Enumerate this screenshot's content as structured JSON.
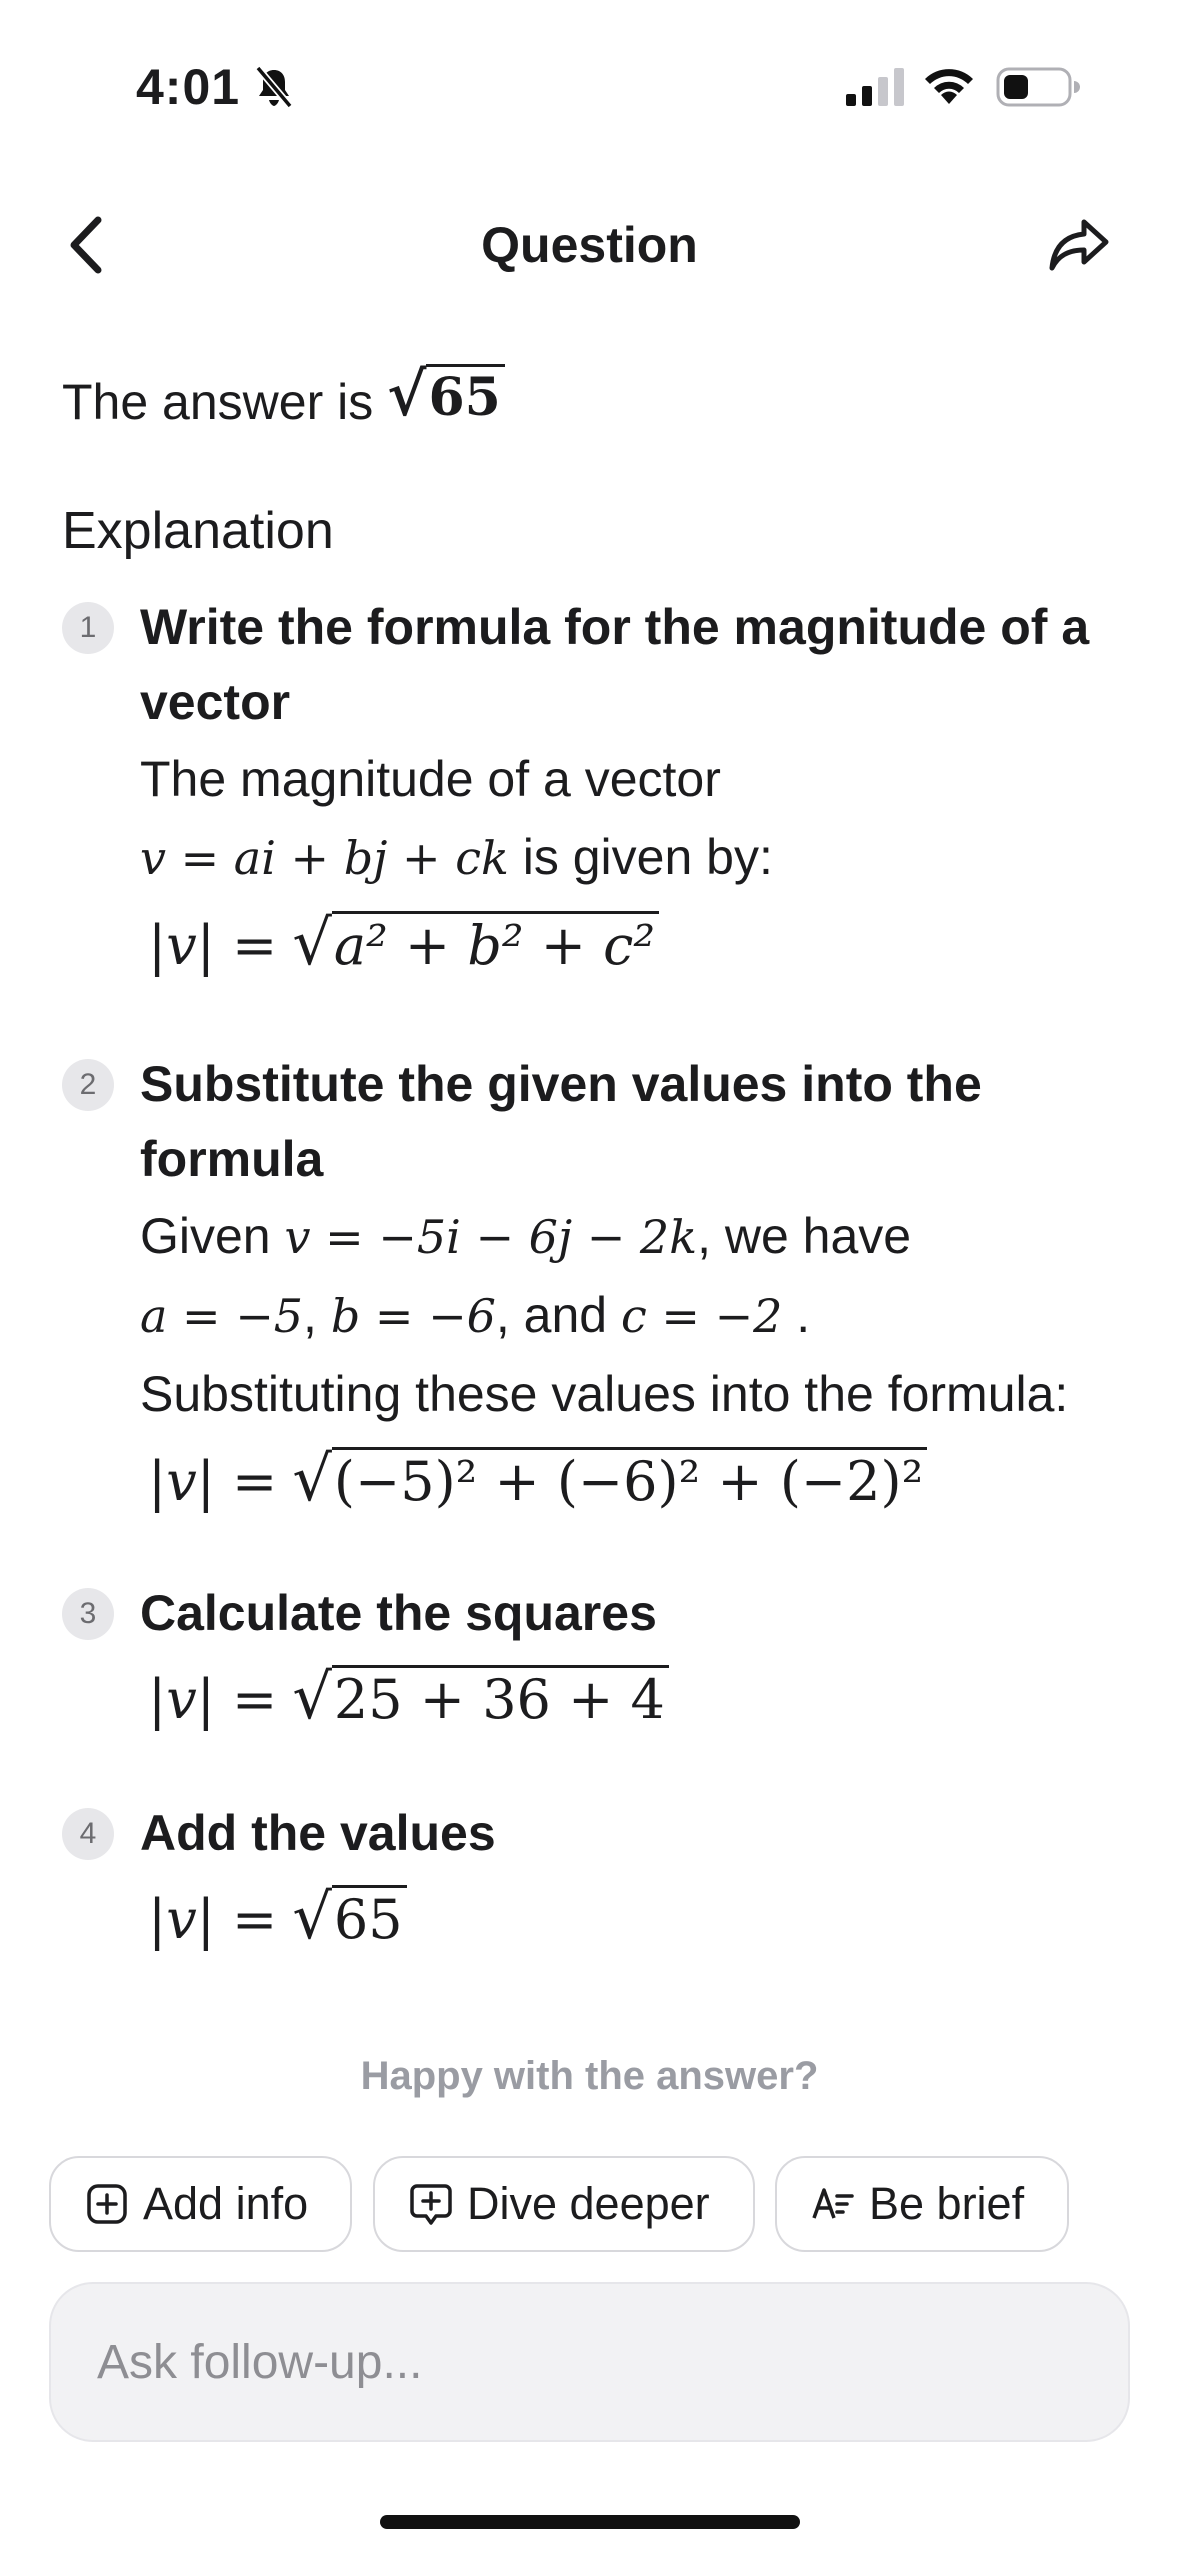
{
  "status": {
    "time": "4:01"
  },
  "nav": {
    "title": "Question"
  },
  "answer": {
    "prefix": "The answer is",
    "value": "65"
  },
  "explanation": {
    "heading": "Explanation",
    "steps": [
      {
        "num": "1",
        "title": "Write the formula for the magnitude of a vector",
        "text1": "The magnitude of a vector",
        "text2_math": "v = ai + bj + ck",
        "text2_suffix": "is given by:",
        "formula_lhs": "|v| =",
        "formula_radicand": "a² + b² + c²"
      },
      {
        "num": "2",
        "title": "Substitute the given values into the formula",
        "given_prefix": "Given",
        "given_math": "v = −5i − 6j − 2k",
        "given_suffix": ", we have",
        "a_math": "a = −5",
        "comma1": ",",
        "b_math": "b = −6",
        "and_text": ", and",
        "c_math": "c = −2",
        "period": ".",
        "text3": "Substituting these values into the formula:",
        "formula_lhs": "|v| =",
        "formula_radicand": "(−5)² + (−6)² + (−2)²"
      },
      {
        "num": "3",
        "title": "Calculate the squares",
        "formula_lhs": "|v| =",
        "formula_radicand": "25 + 36 + 4"
      },
      {
        "num": "4",
        "title": "Add the values",
        "formula_lhs": "|v| =",
        "formula_radicand": "65"
      }
    ]
  },
  "feedback": {
    "prompt": "Happy with the answer?",
    "chips": [
      {
        "label": "Add info",
        "icon": "plus-square-icon"
      },
      {
        "label": "Dive deeper",
        "icon": "plus-bubble-icon"
      },
      {
        "label": "Be brief",
        "icon": "text-shorten-icon"
      }
    ]
  },
  "followup": {
    "placeholder": "Ask follow-up..."
  }
}
